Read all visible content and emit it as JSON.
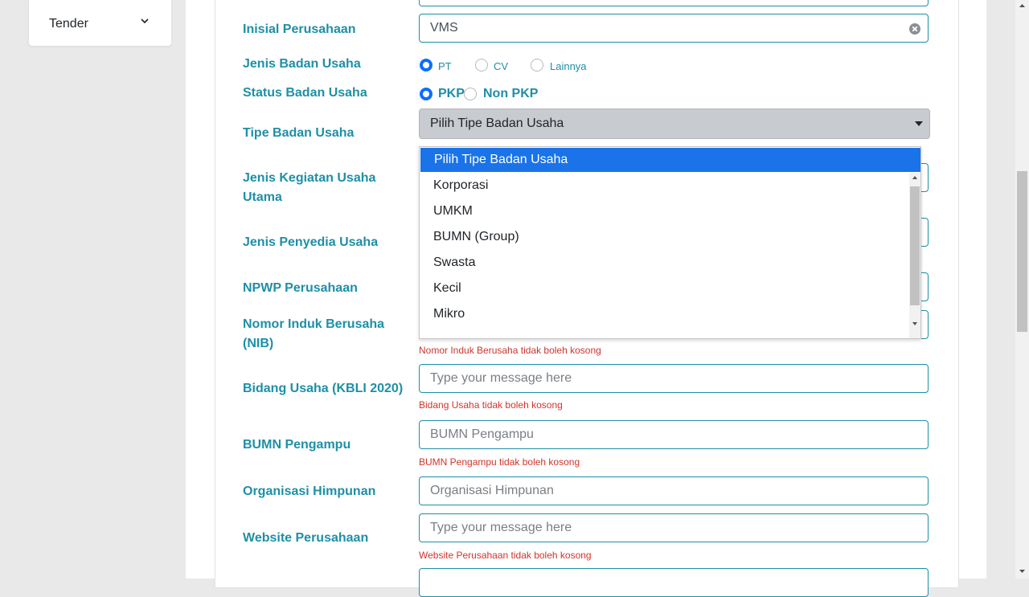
{
  "sidebar": {
    "menu_label": "Tender"
  },
  "form": {
    "inisial": {
      "label": "Inisial Perusahaan",
      "value": "VMS"
    },
    "jenis_badan": {
      "label": "Jenis Badan Usaha",
      "options": [
        "PT",
        "CV",
        "Lainnya"
      ],
      "selected": "PT"
    },
    "status_badan": {
      "label": "Status Badan Usaha",
      "options": [
        "PKP",
        "Non PKP"
      ],
      "selected": "PKP"
    },
    "tipe_badan": {
      "label": "Tipe Badan Usaha",
      "selected_text": "Pilih Tipe Badan Usaha",
      "options": [
        "Pilih Tipe Badan Usaha",
        "Korporasi",
        "UMKM",
        "BUMN (Group)",
        "Swasta",
        "Kecil",
        "Mikro"
      ]
    },
    "jenis_kegiatan": {
      "label": "Jenis Kegiatan Usaha Utama"
    },
    "jenis_penyedia": {
      "label": "Jenis Penyedia Usaha"
    },
    "npwp": {
      "label": "NPWP Perusahaan"
    },
    "nib": {
      "label": "Nomor Induk Berusaha (NIB)",
      "error": "Nomor Induk Berusaha tidak boleh kosong"
    },
    "bidang": {
      "label": "Bidang Usaha (KBLI 2020)",
      "placeholder": "Type your message here",
      "error": "Bidang Usaha tidak boleh kosong"
    },
    "bumn": {
      "label": "BUMN Pengampu",
      "placeholder": "BUMN Pengampu",
      "error": "BUMN Pengampu tidak boleh kosong"
    },
    "organisasi": {
      "label": "Organisasi Himpunan",
      "placeholder": "Organisasi Himpunan"
    },
    "website": {
      "label": "Website Perusahaan",
      "placeholder": "Type your message here",
      "error": "Website Perusahaan tidak boleh kosong"
    }
  },
  "colors": {
    "label": "#1e8fa6",
    "accent": "#0d6efd",
    "error": "#d0342c",
    "option_highlight": "#1a73e8"
  }
}
